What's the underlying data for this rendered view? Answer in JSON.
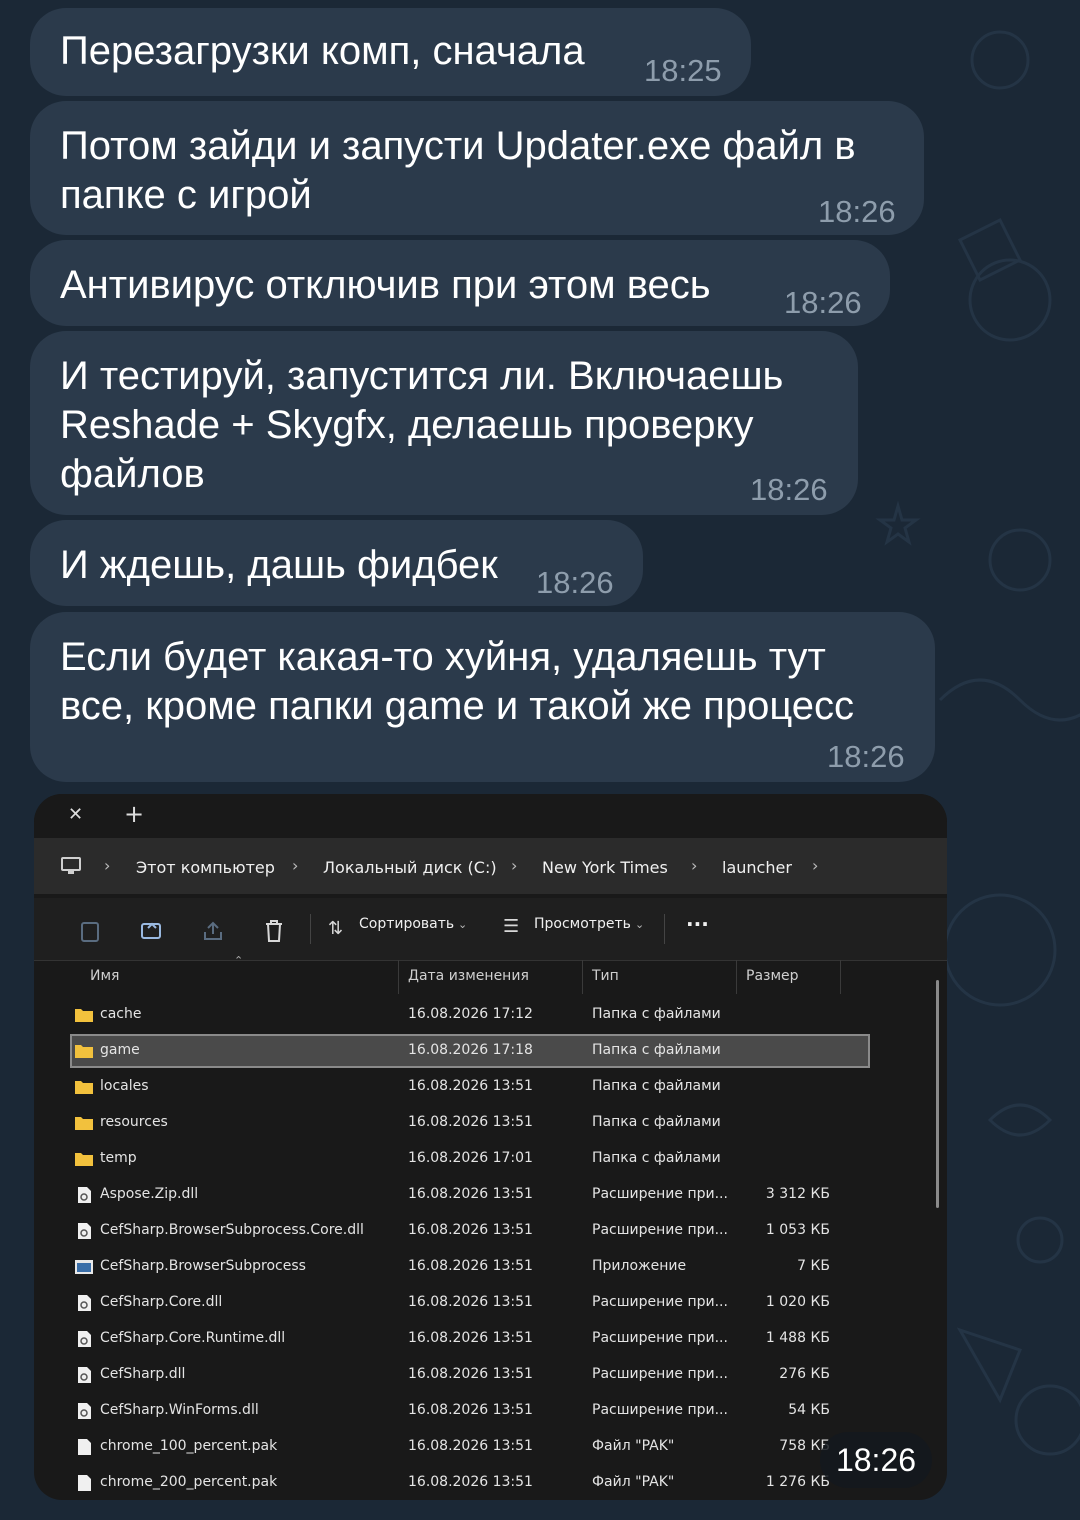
{
  "messages": [
    {
      "text": "Перезагрузки комп, сначала",
      "time": "18:25"
    },
    {
      "text": "Потом зайди и запусти Updater.exe файл в\nпапке с игрой",
      "time": "18:26"
    },
    {
      "text": "Антивирус отключив при этом весь",
      "time": "18:26"
    },
    {
      "text": "И тестируй, запустится ли. Включаешь\nReshade + Skygfx, делаешь проверку\nфайлов",
      "time": "18:26"
    },
    {
      "text": "И ждешь, дашь фидбек",
      "time": "18:26"
    },
    {
      "text": "Если будет какая-то хуйня, удаляешь тут\nвсе, кроме папки game и такой же процесс",
      "time": "18:26"
    }
  ],
  "screenshot_time": "18:26",
  "explorer": {
    "tab_close": "✕",
    "tab_add": "+",
    "breadcrumb": [
      "Этот компьютер",
      "Локальный диск (C:)",
      "New York Times",
      "launcher"
    ],
    "toolbar": {
      "sort_label": "Сортировать",
      "view_label": "Просмотреть",
      "more_label": "···"
    },
    "columns": [
      "Имя",
      "Дата изменения",
      "Тип",
      "Размер"
    ],
    "files": [
      {
        "name": "cache",
        "date": "16.08.2026 17:12",
        "type": "Папка с файлами",
        "size": "",
        "icon": "folder-icon"
      },
      {
        "name": "game",
        "date": "16.08.2026 17:18",
        "type": "Папка с файлами",
        "size": "",
        "icon": "folder-icon"
      },
      {
        "name": "locales",
        "date": "16.08.2026 13:51",
        "type": "Папка с файлами",
        "size": "",
        "icon": "folder-icon"
      },
      {
        "name": "resources",
        "date": "16.08.2026 13:51",
        "type": "Папка с файлами",
        "size": "",
        "icon": "folder-icon"
      },
      {
        "name": "temp",
        "date": "16.08.2026 17:01",
        "type": "Папка с файлами",
        "size": "",
        "icon": "folder-icon"
      },
      {
        "name": "Aspose.Zip.dll",
        "date": "16.08.2026 13:51",
        "type": "Расширение при...",
        "size": "3 312 КБ",
        "icon": "dll-file-icon"
      },
      {
        "name": "CefSharp.BrowserSubprocess.Core.dll",
        "date": "16.08.2026 13:51",
        "type": "Расширение при...",
        "size": "1 053 КБ",
        "icon": "dll-file-icon"
      },
      {
        "name": "CefSharp.BrowserSubprocess",
        "date": "16.08.2026 13:51",
        "type": "Приложение",
        "size": "7 КБ",
        "icon": "app-file-icon"
      },
      {
        "name": "CefSharp.Core.dll",
        "date": "16.08.2026 13:51",
        "type": "Расширение при...",
        "size": "1 020 КБ",
        "icon": "dll-file-icon"
      },
      {
        "name": "CefSharp.Core.Runtime.dll",
        "date": "16.08.2026 13:51",
        "type": "Расширение при...",
        "size": "1 488 КБ",
        "icon": "dll-file-icon"
      },
      {
        "name": "CefSharp.dll",
        "date": "16.08.2026 13:51",
        "type": "Расширение при...",
        "size": "276 КБ",
        "icon": "dll-file-icon"
      },
      {
        "name": "CefSharp.WinForms.dll",
        "date": "16.08.2026 13:51",
        "type": "Расширение при...",
        "size": "54 КБ",
        "icon": "dll-file-icon"
      },
      {
        "name": "chrome_100_percent.pak",
        "date": "16.08.2026 13:51",
        "type": "Файл \"PAK\"",
        "size": "758 КБ",
        "icon": "file-icon"
      },
      {
        "name": "chrome_200_percent.pak",
        "date": "16.08.2026 13:51",
        "type": "Файл \"PAK\"",
        "size": "1 276 КБ",
        "icon": "file-icon"
      }
    ]
  }
}
